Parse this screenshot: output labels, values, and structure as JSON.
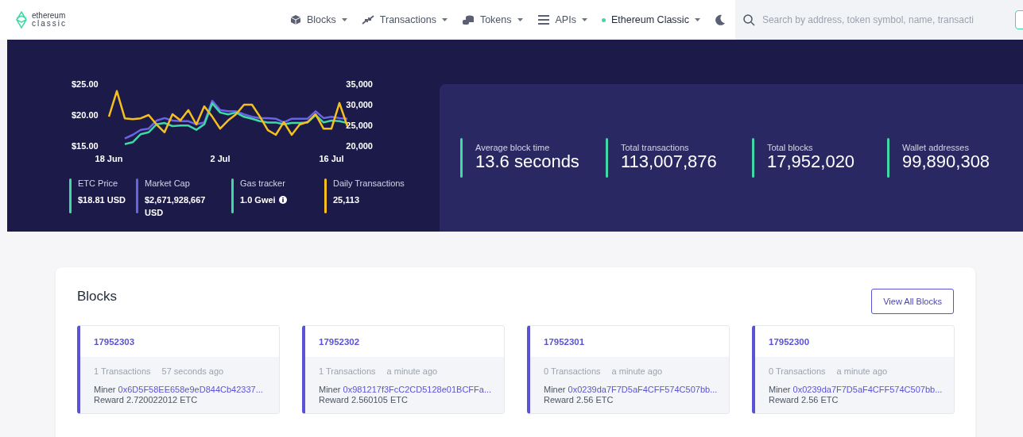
{
  "header": {
    "logo": {
      "line1": "ethereum",
      "line2": "classic"
    },
    "nav": [
      {
        "label": "Blocks"
      },
      {
        "label": "Transactions"
      },
      {
        "label": "Tokens"
      },
      {
        "label": "APIs"
      }
    ],
    "network": {
      "label": "Ethereum Classic",
      "color": "#3fd9a5"
    },
    "search": {
      "placeholder": "Search by address, token symbol, name, transacti"
    }
  },
  "hero": {
    "chart_data": {
      "type": "line",
      "categories": [
        "18 Jun",
        null,
        null,
        null,
        null,
        null,
        null,
        null,
        null,
        null,
        null,
        null,
        null,
        null,
        "2 Jul",
        null,
        null,
        null,
        null,
        null,
        null,
        null,
        null,
        null,
        null,
        null,
        null,
        null,
        "16 Jul",
        null,
        null
      ],
      "ylim": [
        15,
        25
      ],
      "yticks": [
        {
          "value": 15,
          "label": "$15.00"
        },
        {
          "value": 20,
          "label": "$20.00"
        },
        {
          "value": 25,
          "label": "$25.00"
        }
      ],
      "y2lim": [
        20000,
        35000
      ],
      "y2ticks": [
        {
          "value": 20000,
          "label": "20,000"
        },
        {
          "value": 25000,
          "label": "25,000"
        },
        {
          "value": 30000,
          "label": "30,000"
        },
        {
          "value": 35000,
          "label": "35,000"
        }
      ],
      "series": [
        {
          "color": "#6b63e6",
          "values": [
            null,
            null,
            16.2,
            16.8,
            17.6,
            17.8,
            19.1,
            19.5,
            19.1,
            19.0,
            19.0,
            18.5,
            18.8,
            22.3,
            20.8,
            20.6,
            20.6,
            20.1,
            19.7,
            19.5,
            19.5,
            19.4,
            18.8,
            19.4,
            19.4,
            19.4,
            20.6,
            19.5,
            19.7,
            19.5,
            19.4
          ]
        },
        {
          "color": "#3fd9a5",
          "values": [
            null,
            null,
            15.3,
            15.6,
            16.9,
            17.2,
            18.5,
            18.7,
            18.2,
            18.3,
            18.3,
            17.6,
            18.5,
            21.9,
            20.4,
            20.1,
            20.4,
            19.7,
            19.4,
            19.0,
            18.8,
            18.8,
            18.5,
            18.7,
            18.7,
            18.8,
            20.0,
            18.8,
            19.1,
            19.0,
            18.7
          ]
        },
        {
          "color": "#f5c01e",
          "axis": "y2",
          "values": [
            27100,
            33300,
            26700,
            26500,
            26700,
            27500,
            25200,
            23300,
            27700,
            26200,
            28700,
            25200,
            29600,
            27100,
            24200,
            26200,
            27700,
            30000,
            30000,
            27100,
            23800,
            22700,
            25800,
            22700,
            25200,
            25800,
            27700,
            24200,
            24200,
            30400,
            24800
          ]
        }
      ]
    },
    "stats": [
      {
        "label": "ETC Price",
        "value": "$18.81 USD",
        "color": "#3fd9a5",
        "info": false
      },
      {
        "label": "Market Cap",
        "value": "$2,671,928,667 USD",
        "color": "#6b63e6",
        "info": false
      },
      {
        "label": "Gas tracker",
        "value": "1.0 Gwei",
        "color": "#3fd9a5",
        "info": true
      },
      {
        "label": "Daily Transactions",
        "value": "25,113",
        "color": "#f5c01e",
        "info": false
      }
    ],
    "summary": [
      {
        "label": "Average block time",
        "value": "13.6 seconds"
      },
      {
        "label": "Total transactions",
        "value": "113,007,876"
      },
      {
        "label": "Total blocks",
        "value": "17,952,020"
      },
      {
        "label": "Wallet addresses",
        "value": "99,890,308"
      }
    ]
  },
  "blocks": {
    "title": "Blocks",
    "button": "View All Blocks",
    "items": [
      {
        "number": "17952303",
        "transactions": "1 Transactions",
        "age": "57 seconds ago",
        "miner_label": "Miner",
        "miner": "0x6D5F58EE658e9eD844Cb42337...",
        "reward": "Reward 2.720022012 ETC"
      },
      {
        "number": "17952302",
        "transactions": "1 Transactions",
        "age": "a minute ago",
        "miner_label": "Miner",
        "miner": "0x981217f3FcC2CD5128e01BCFFa...",
        "reward": "Reward 2.560105 ETC"
      },
      {
        "number": "17952301",
        "transactions": "0 Transactions",
        "age": "a minute ago",
        "miner_label": "Miner",
        "miner": "0x0239da7F7D5aF4CFF574C507bb...",
        "reward": "Reward 2.56 ETC"
      },
      {
        "number": "17952300",
        "transactions": "0 Transactions",
        "age": "a minute ago",
        "miner_label": "Miner",
        "miner": "0x0239da7F7D5aF4CFF574C507bb...",
        "reward": "Reward 2.56 ETC"
      }
    ]
  }
}
